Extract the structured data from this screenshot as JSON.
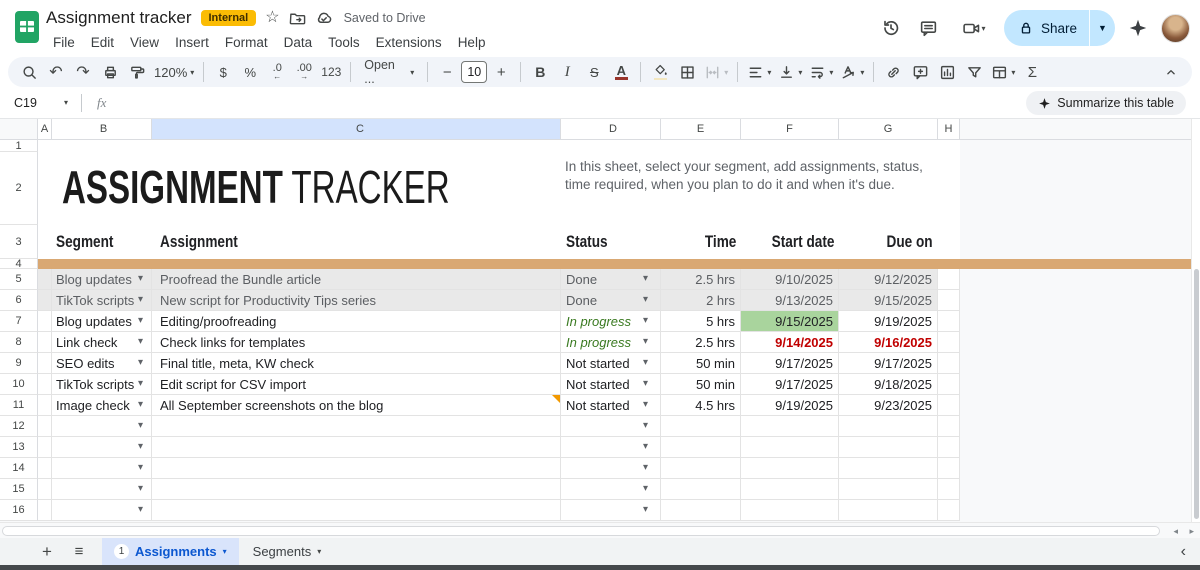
{
  "app": {
    "title": "Assignment tracker",
    "badge": "Internal",
    "saved": "Saved to Drive",
    "menus": [
      "File",
      "Edit",
      "View",
      "Insert",
      "Format",
      "Data",
      "Tools",
      "Extensions",
      "Help"
    ],
    "share_label": "Share"
  },
  "toolbar": {
    "zoom": "120%",
    "currency": "$",
    "percent": "%",
    "decrease_decimal": ".0",
    "increase_decimal": ".00",
    "number_format": "123",
    "font_name": "Open ...",
    "font_size": "10",
    "bold": "B",
    "italic": "I",
    "strikethrough": "S",
    "text_color": "A",
    "functions": "Σ"
  },
  "formula_bar": {
    "cell_ref": "C19",
    "fx": "fx",
    "summarize": "Summarize this table"
  },
  "sheet": {
    "col_letters": [
      "A",
      "B",
      "C",
      "D",
      "E",
      "F",
      "G",
      "H"
    ],
    "row_numbers": [
      "1",
      "2",
      "3",
      "4",
      "5",
      "6",
      "7",
      "8",
      "9",
      "10",
      "11",
      "12",
      "13",
      "14",
      "15",
      "16"
    ],
    "title_bold": "ASSIGNMENT",
    "title_light": " TRACKER",
    "description": "In this sheet, select your segment, add assignments, status, time required, when you plan to do it and when it's due.",
    "headers": {
      "segment": "Segment",
      "assignment": "Assignment",
      "status": "Status",
      "time": "Time",
      "start": "Start date",
      "due": "Due on"
    },
    "rows": [
      {
        "segment": "Blog updates",
        "assignment": "Proofread the Bundle article",
        "status": "Done",
        "time": "2.5 hrs",
        "start": "9/10/2025",
        "due": "9/12/2025"
      },
      {
        "segment": "TikTok scripts",
        "assignment": "New script for Productivity Tips series",
        "status": "Done",
        "time": "2 hrs",
        "start": "9/13/2025",
        "due": "9/15/2025"
      },
      {
        "segment": "Blog updates",
        "assignment": "Editing/proofreading",
        "status": "In progress",
        "time": "5 hrs",
        "start": "9/15/2025",
        "due": "9/19/2025"
      },
      {
        "segment": "Link check",
        "assignment": "Check links for templates",
        "status": "In progress",
        "time": "2.5 hrs",
        "start": "9/14/2025",
        "due": "9/16/2025"
      },
      {
        "segment": "SEO edits",
        "assignment": "Final title, meta, KW check",
        "status": "Not started",
        "time": "50 min",
        "start": "9/17/2025",
        "due": "9/17/2025"
      },
      {
        "segment": "TikTok scripts",
        "assignment": "Edit script for CSV import",
        "status": "Not started",
        "time": "50 min",
        "start": "9/17/2025",
        "due": "9/18/2025"
      },
      {
        "segment": "Image check",
        "assignment": "All September screenshots on the blog",
        "status": "Not started",
        "time": "4.5 hrs",
        "start": "9/19/2025",
        "due": "9/23/2025"
      }
    ]
  },
  "tabs": {
    "badge": "1",
    "active": "Assignments",
    "other": "Segments"
  },
  "colors": {
    "accent": "#0b57d0",
    "band": "#d9a873",
    "done_bg": "#e9e9e9",
    "green_cell": "#a9d49d",
    "green_text": "#3a7a21",
    "red_text": "#c00000",
    "internal_badge": "#fbbc04",
    "share_bg": "#c2e7ff",
    "selected_col": "#d3e3fd"
  }
}
